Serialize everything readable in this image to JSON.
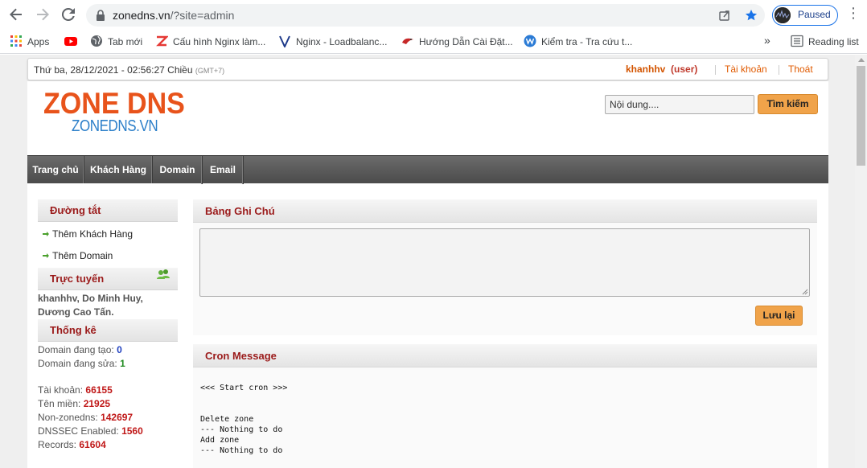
{
  "browser": {
    "url_host": "zonedns.vn",
    "url_path": "/?site=admin",
    "profile_label": "Paused",
    "bookmarks": [
      {
        "label": "Apps",
        "icon": "apps-grid-icon"
      },
      {
        "label": "",
        "icon": "youtube-icon"
      },
      {
        "label": "Tab mới",
        "icon": "globe-icon"
      },
      {
        "label": "Cấu hình Nginx làm...",
        "icon": "z-logo-icon"
      },
      {
        "label": "Nginx - Loadbalanc...",
        "icon": "v-logo-icon"
      },
      {
        "label": "Hướng Dẫn Cài Đặt...",
        "icon": "bird-logo-icon"
      },
      {
        "label": "Kiểm tra - Tra cứu t...",
        "icon": "w-logo-icon"
      }
    ],
    "overflow": "»",
    "reading_list": "Reading list"
  },
  "topbar": {
    "date": "Thứ ba, 28/12/2021 - 02:56:27 Chiều",
    "tz": "(GMT+7)",
    "username": "khanhhv",
    "role": "(user)",
    "account_link": "Tài khoản",
    "logout_link": "Thoát"
  },
  "header": {
    "logo_big": "ZONE DNS",
    "logo_small": "ZONEDNS.VN",
    "search_value": "Nội dung....",
    "search_button": "Tìm kiếm"
  },
  "nav": {
    "items": [
      "Trang chủ",
      "Khách Hàng",
      "Domain",
      "Email"
    ]
  },
  "sidebar": {
    "shortcuts_title": "Đường tắt",
    "shortcuts": [
      "Thêm Khách Hàng",
      "Thêm Domain"
    ],
    "online_title": "Trực tuyến",
    "online_users_line1": "khanhhv, Do Minh Huy,",
    "online_users_line2": "Dương Cao Tấn.",
    "stats_title": "Thống kê",
    "stats": {
      "creating_label": "Domain đang tạo:",
      "creating_value": "0",
      "editing_label": "Domain đang sửa:",
      "editing_value": "1",
      "accounts_label": "Tài khoản:",
      "accounts_value": "66155",
      "domains_label": "Tên miền:",
      "domains_value": "21925",
      "nonzone_label": "Non-zonedns:",
      "nonzone_value": "142697",
      "dnssec_label": "DNSSEC Enabled:",
      "dnssec_value": "1560",
      "records_label": "Records:",
      "records_value": "61604"
    }
  },
  "notes": {
    "title": "Bảng Ghi Chú",
    "value": "",
    "save_button": "Lưu lại"
  },
  "cron": {
    "title": "Cron Message",
    "start": "<<< Start cron >>>",
    "lines": [
      "Delete zone",
      "--- Nothing to do",
      "Add zone",
      "--- Nothing to do"
    ]
  },
  "colors": {
    "accent_orange": "#f0a34a",
    "heading_red": "#9b1b1b",
    "logo_orange": "#e8531b",
    "logo_blue": "#2c7fc9"
  }
}
